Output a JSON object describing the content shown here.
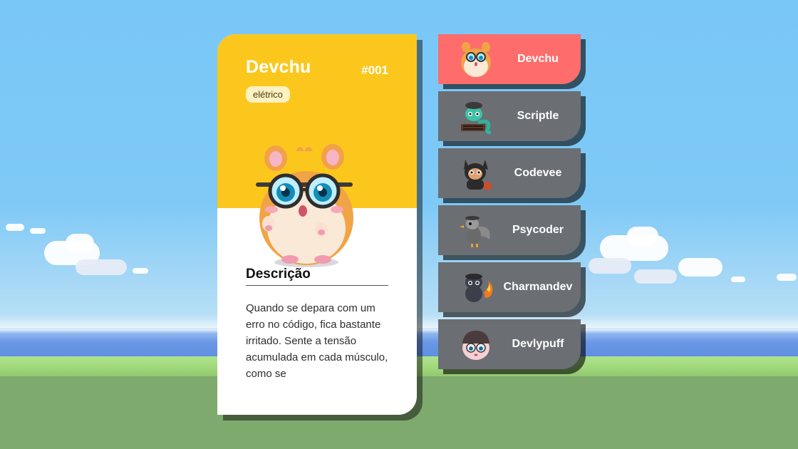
{
  "card": {
    "name": "Devchu",
    "number": "#001",
    "type": "elétrico",
    "description_title": "Descrição",
    "description": "Quando se depara com um erro no código, fica bastante irritado. Sente a tensão acumulada em cada músculo, como se",
    "top_color": "#fcc71d"
  },
  "list": {
    "active_color": "#ff6c6c",
    "inactive_color": "#6b6e72",
    "items": [
      {
        "label": "Devchu",
        "icon": "hamster-glasses-icon",
        "active": true
      },
      {
        "label": "Scriptle",
        "icon": "snake-keyboard-icon",
        "active": false
      },
      {
        "label": "Codevee",
        "icon": "fox-hoodie-icon",
        "active": false
      },
      {
        "label": "Psycoder",
        "icon": "duck-hat-icon",
        "active": false
      },
      {
        "label": "Charmandev",
        "icon": "lizard-flame-icon",
        "active": false
      },
      {
        "label": "Devlypuff",
        "icon": "puff-beanie-icon",
        "active": false
      }
    ]
  }
}
